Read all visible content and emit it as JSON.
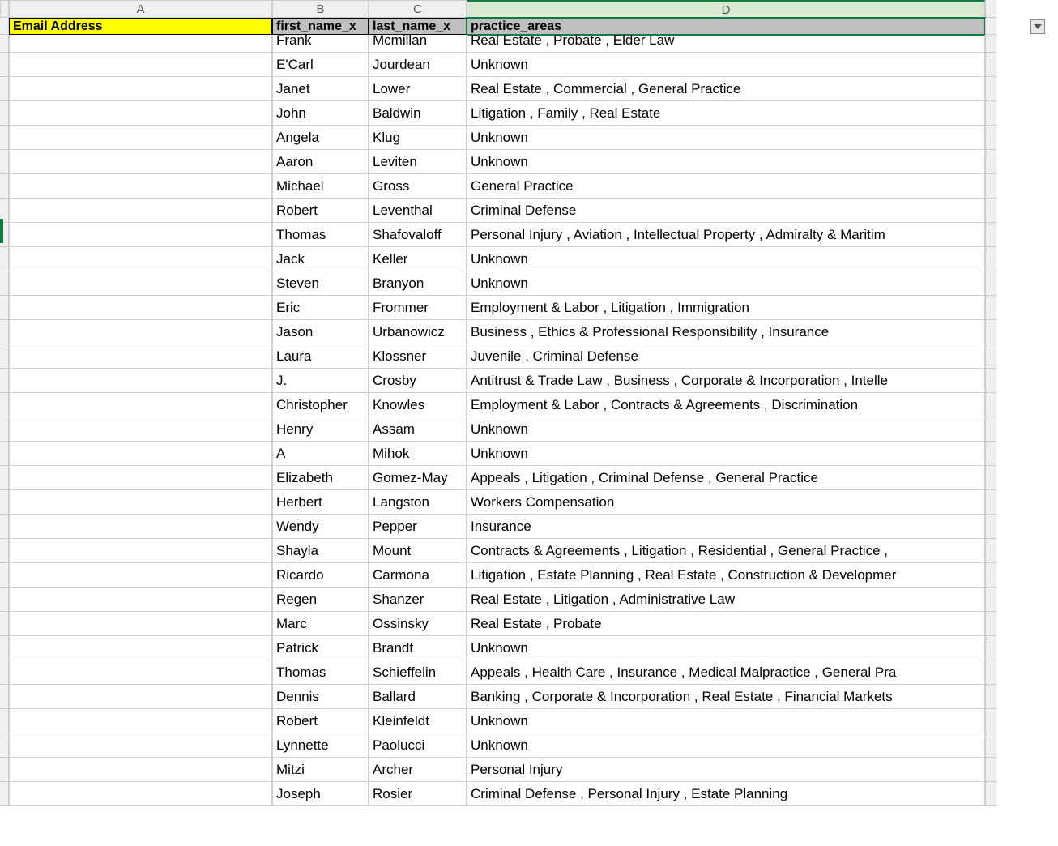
{
  "columns": {
    "A": "A",
    "B": "B",
    "C": "C",
    "D": "D"
  },
  "headers": {
    "email": "Email Address",
    "first": "first_name_x",
    "last": "last_name_x",
    "practice": "practice_areas"
  },
  "rows": [
    {
      "email": "",
      "first": "Frank",
      "last": "Mcmillan",
      "practice": "Real Estate , Probate , Elder Law"
    },
    {
      "email": "",
      "first": "E'Carl",
      "last": "Jourdean",
      "practice": "Unknown"
    },
    {
      "email": "",
      "first": "Janet",
      "last": "Lower",
      "practice": "Real Estate , Commercial , General Practice"
    },
    {
      "email": "",
      "first": "John",
      "last": "Baldwin",
      "practice": "Litigation , Family , Real Estate"
    },
    {
      "email": "",
      "first": "Angela",
      "last": "Klug",
      "practice": "Unknown"
    },
    {
      "email": "",
      "first": "Aaron",
      "last": "Leviten",
      "practice": "Unknown"
    },
    {
      "email": "",
      "first": "Michael",
      "last": "Gross",
      "practice": "General Practice"
    },
    {
      "email": "",
      "first": "Robert",
      "last": "Leventhal",
      "practice": "Criminal Defense"
    },
    {
      "email": "",
      "first": "Thomas",
      "last": "Shafovaloff",
      "practice": "Personal Injury , Aviation , Intellectual Property , Admiralty & Maritim"
    },
    {
      "email": "",
      "first": "Jack",
      "last": "Keller",
      "practice": "Unknown"
    },
    {
      "email": "",
      "first": "Steven",
      "last": "Branyon",
      "practice": "Unknown"
    },
    {
      "email": "",
      "first": "Eric",
      "last": "Frommer",
      "practice": "Employment & Labor , Litigation , Immigration"
    },
    {
      "email": "",
      "first": "Jason",
      "last": "Urbanowicz",
      "practice": "Business , Ethics & Professional Responsibility , Insurance"
    },
    {
      "email": "",
      "first": "Laura",
      "last": "Klossner",
      "practice": "Juvenile , Criminal Defense"
    },
    {
      "email": "",
      "first": "J.",
      "last": "Crosby",
      "practice": "Antitrust & Trade Law , Business , Corporate & Incorporation , Intelle"
    },
    {
      "email": "",
      "first": "Christopher",
      "last": "Knowles",
      "practice": "Employment & Labor , Contracts & Agreements , Discrimination"
    },
    {
      "email": "",
      "first": "Henry",
      "last": "Assam",
      "practice": "Unknown"
    },
    {
      "email": "",
      "first": "A",
      "last": "Mihok",
      "practice": "Unknown"
    },
    {
      "email": "",
      "first": "Elizabeth",
      "last": "Gomez-May",
      "practice": "Appeals , Litigation , Criminal Defense , General Practice"
    },
    {
      "email": "",
      "first": "Herbert",
      "last": "Langston",
      "practice": "Workers Compensation"
    },
    {
      "email": "",
      "first": "Wendy",
      "last": "Pepper",
      "practice": "Insurance"
    },
    {
      "email": "",
      "first": "Shayla",
      "last": "Mount",
      "practice": "Contracts & Agreements , Litigation , Residential , General Practice ,"
    },
    {
      "email": "",
      "first": "Ricardo",
      "last": "Carmona",
      "practice": "Litigation , Estate Planning , Real Estate , Construction & Developmer"
    },
    {
      "email": "",
      "first": "Regen",
      "last": "Shanzer",
      "practice": "Real Estate , Litigation , Administrative Law"
    },
    {
      "email": "",
      "first": "Marc",
      "last": "Ossinsky",
      "practice": "Real Estate , Probate"
    },
    {
      "email": "",
      "first": "Patrick",
      "last": "Brandt",
      "practice": "Unknown"
    },
    {
      "email": "",
      "first": "Thomas",
      "last": "Schieffelin",
      "practice": "Appeals , Health Care , Insurance , Medical Malpractice , General Pra"
    },
    {
      "email": "",
      "first": "Dennis",
      "last": "Ballard",
      "practice": "Banking , Corporate & Incorporation , Real Estate , Financial Markets"
    },
    {
      "email": "",
      "first": "Robert",
      "last": "Kleinfeldt",
      "practice": "Unknown"
    },
    {
      "email": "",
      "first": "Lynnette",
      "last": "Paolucci",
      "practice": "Unknown"
    },
    {
      "email": "",
      "first": "Mitzi",
      "last": "Archer",
      "practice": "Personal Injury"
    },
    {
      "email": "",
      "first": "Joseph",
      "last": "Rosier",
      "practice": "Criminal Defense , Personal Injury , Estate Planning"
    }
  ]
}
